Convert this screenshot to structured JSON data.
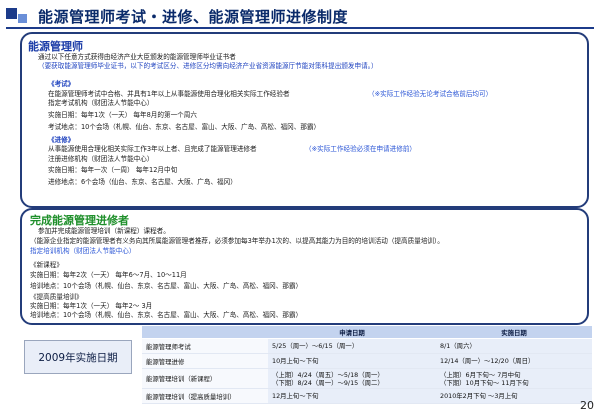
{
  "header": {
    "title": "能源管理师考试・进修、能源管理师进修制度"
  },
  "section_exam": {
    "heading": "能源管理师",
    "intro": "通过以下任意方式获得由经济产业大臣颁发的能源管理师毕业证书者",
    "notice": "（要获取能源管理师毕业证书，以下的考试区分、进修区分均需向经济产业省资源能源厅节能对策科提出颁发申请。）",
    "exam_heading": "《考试》",
    "exam_desc": "在能源管理师考试中合格、并具有1年以上从事能源使用合理化相关实际工作经验者",
    "exam_note": "（※实际工作经验无论考试合格前后均可）",
    "exam_org": "指定考试机构（财团法人节能中心）",
    "exam_date": "实施日期：每年1次（一天）   每年8月的第一个周六",
    "exam_place": "考试地点：10个会场（札幌、仙台、东京、名古屋、富山、大阪、广岛、高松、福冈、那霸）",
    "training_heading": "《进修》",
    "training_desc": "从事能源使用合理化相关实际工作3年以上者、且完成了能源管理进修者",
    "training_note": "（※实际工作经验必须在申请进修前）",
    "training_org": "注册进修机构（财团法人节能中心）",
    "training_date": "实施日期：每年一次（一周）   每年12月中旬",
    "training_place": "进修地点：6个会场（仙台、东京、名古屋、大阪、广岛、福冈）"
  },
  "section_training": {
    "heading": "完成能源管理进修者",
    "intro": "参加并完成能源管理培训（新课程）课程者。",
    "desc": "（能源企业指定的能源管理者有义务向其所属能源管理者推荐，必须参加每3年举办1次的、以提高其能力为目的的培训活动（提高质量培训）。",
    "org": "指定培训机构（财团法人节能中心）",
    "new_heading": "《新课程》",
    "new_date": "实施日期：每年2次（一天）   每年6～7月、10～11月",
    "new_place": "培训地点：10个会场（札幌、仙台、东京、名古屋、富山、大阪、广岛、高松、福冈、那霸）",
    "quality_heading": "《提高质量培训》",
    "quality_date": "实施日期：每年1次（一天）   每年2～ 3月",
    "quality_place": "培训地点：10个会场（札幌、仙台、东京、名古屋、富山、大阪、广岛、高松、福冈、那霸）"
  },
  "year_label": "2009年实施日期",
  "schedule": {
    "headers": [
      "",
      "申请日期",
      "实施日期"
    ],
    "rows": [
      {
        "item": "能源管理师考试",
        "apply": [
          "5/25（周一）～6/15（周一）"
        ],
        "held": [
          "8/1（周六）"
        ]
      },
      {
        "item": "能源管理进修",
        "apply": [
          "10月上旬～下旬"
        ],
        "held": [
          "12/14（周一）～12/20（周日）"
        ]
      },
      {
        "item": "能源管理培训（新课程）",
        "apply": [
          "（上期）4/24（周五）～5/18（周一）",
          "（下期）8/24（周一）～9/15（周二）"
        ],
        "held": [
          "（上期）6月下旬～ 7月中旬",
          "（下期）10月下旬～ 11月下旬"
        ]
      },
      {
        "item": "能源管理培训（提高质量培训）",
        "apply": [
          "12月上旬～下旬"
        ],
        "held": [
          "2010年2月下旬 ～3月上旬"
        ]
      }
    ]
  },
  "page_number": "20"
}
